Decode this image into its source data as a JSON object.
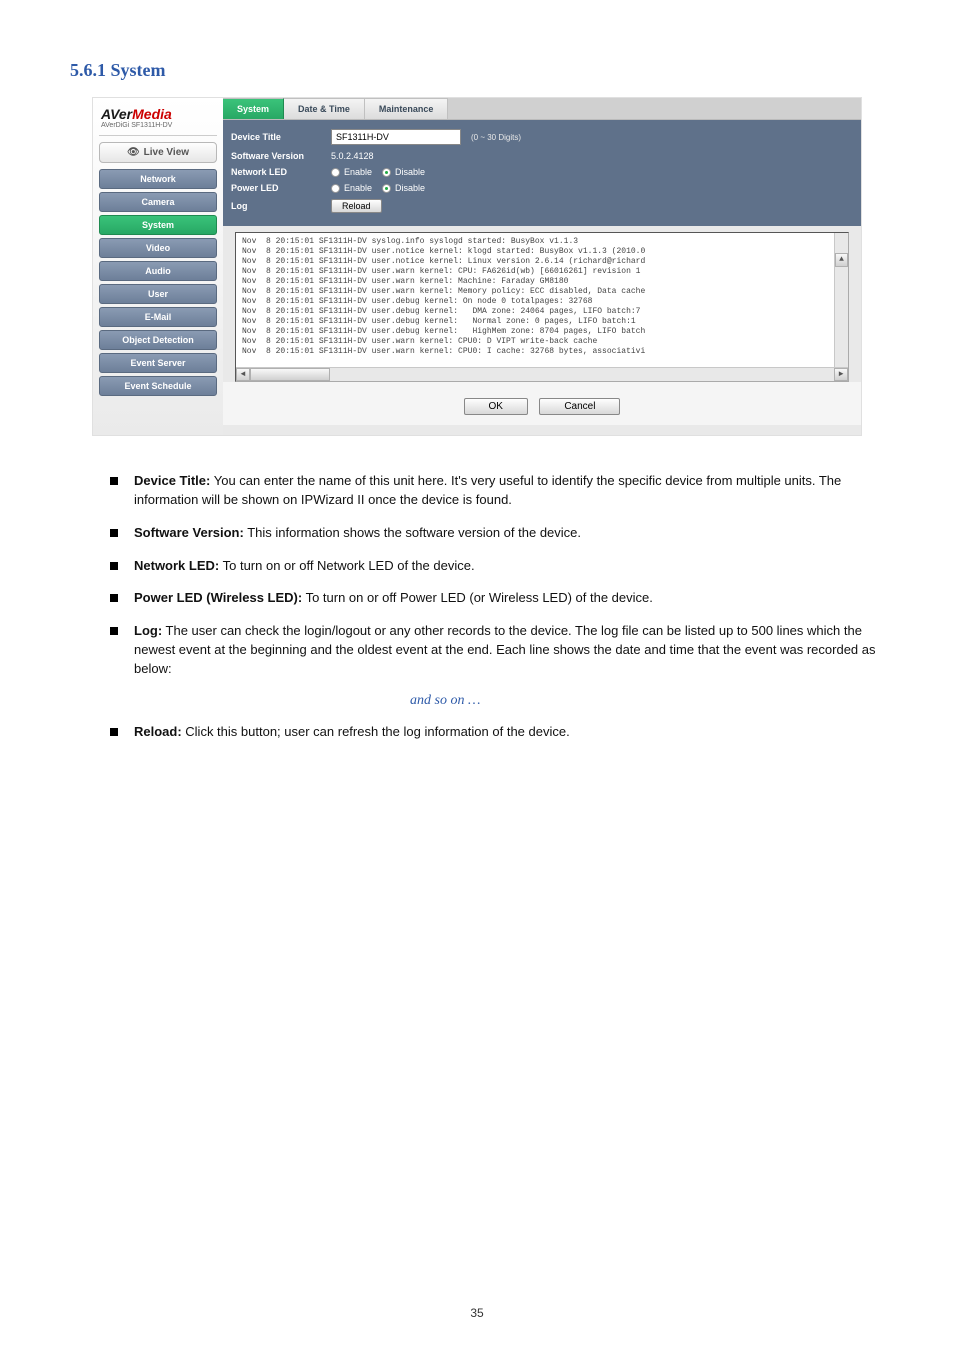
{
  "page": {
    "section_title": "5.6.1  System",
    "footer": "35",
    "and_so_on": "and so on …"
  },
  "logo": {
    "brand_a": "AVer",
    "brand_b": "Media",
    "subline": "AVerDiGi SF1311H-DV"
  },
  "sidebar": {
    "live_view": "Live View",
    "items": [
      {
        "label": "Network",
        "active": false
      },
      {
        "label": "Camera",
        "active": false
      },
      {
        "label": "System",
        "active": true
      },
      {
        "label": "Video",
        "active": false
      },
      {
        "label": "Audio",
        "active": false
      },
      {
        "label": "User",
        "active": false
      },
      {
        "label": "E-Mail",
        "active": false
      },
      {
        "label": "Object Detection",
        "active": false
      },
      {
        "label": "Event Server",
        "active": false
      },
      {
        "label": "Event Schedule",
        "active": false
      }
    ]
  },
  "tabs": [
    {
      "label": "System",
      "active": true
    },
    {
      "label": "Date & Time",
      "active": false
    },
    {
      "label": "Maintenance",
      "active": false
    }
  ],
  "form": {
    "device_title_label": "Device Title",
    "device_title_value": "SF1311H-DV",
    "device_title_hint": "(0 ~ 30 Digits)",
    "software_version_label": "Software Version",
    "software_version_value": "5.0.2.4128",
    "network_led_label": "Network LED",
    "power_led_label": "Power LED",
    "enable": "Enable",
    "disable": "Disable",
    "log_label": "Log",
    "reload": "Reload"
  },
  "log_lines": [
    "Nov  8 20:15:01 SF1311H-DV syslog.info syslogd started: BusyBox v1.1.3",
    "Nov  8 20:15:01 SF1311H-DV user.notice kernel: klogd started: BusyBox v1.1.3 (2010.0",
    "Nov  8 20:15:01 SF1311H-DV user.notice kernel: Linux version 2.6.14 (richard@richard",
    "Nov  8 20:15:01 SF1311H-DV user.warn kernel: CPU: FA626id(wb) [66016261] revision 1",
    "Nov  8 20:15:01 SF1311H-DV user.warn kernel: Machine: Faraday GM8180",
    "Nov  8 20:15:01 SF1311H-DV user.warn kernel: Memory policy: ECC disabled, Data cache",
    "Nov  8 20:15:01 SF1311H-DV user.debug kernel: On node 0 totalpages: 32768",
    "Nov  8 20:15:01 SF1311H-DV user.debug kernel:   DMA zone: 24064 pages, LIFO batch:7",
    "Nov  8 20:15:01 SF1311H-DV user.debug kernel:   Normal zone: 0 pages, LIFO batch:1",
    "Nov  8 20:15:01 SF1311H-DV user.debug kernel:   HighMem zone: 8704 pages, LIFO batch",
    "Nov  8 20:15:01 SF1311H-DV user.warn kernel: CPU0: D VIPT write-back cache",
    "Nov  8 20:15:01 SF1311H-DV user.warn kernel: CPU0: I cache: 32768 bytes, associativi"
  ],
  "buttons": {
    "ok": "OK",
    "cancel": "Cancel"
  },
  "bullets": [
    {
      "lead": "Device Title:",
      "rest": " You can enter the name of this unit here. It's very useful to identify the specific device from multiple units. The information will be shown on IPWizard II once the device is found."
    },
    {
      "lead": "Software Version:",
      "rest": " This information shows the software version of the device."
    },
    {
      "lead": "Network LED:",
      "rest": " To turn on or off Network LED of the device."
    },
    {
      "lead": "Power LED (Wireless LED):",
      "rest": " To turn on or off Power LED (or Wireless LED) of the device."
    },
    {
      "lead": "Log:",
      "rest": " The user can check the login/logout or any other records to the device. The log file can be listed up to 500 lines which the newest event at the beginning and the oldest event at the end. Each line shows the date and time that the event was recorded as below:"
    },
    {
      "lead": "Reload:",
      "rest": " Click this button; user can refresh the log information of the device."
    }
  ]
}
